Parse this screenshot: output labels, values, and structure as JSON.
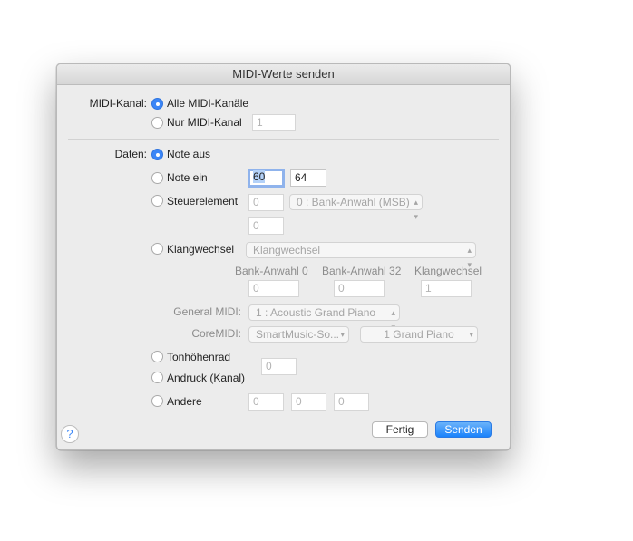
{
  "window": {
    "title": "MIDI-Werte senden"
  },
  "midi_kanal": {
    "label": "MIDI-Kanal:",
    "option_all": "Alle MIDI-Kanäle",
    "option_only": "Nur MIDI-Kanal",
    "channel_value": "1",
    "selected": "all"
  },
  "daten": {
    "label": "Daten:",
    "note_aus": "Note aus",
    "note_ein": "Note ein",
    "note_ein_value1": "60",
    "note_ein_value2": "64",
    "steuerelement": "Steuerelement",
    "steuer_value": "0",
    "steuer_popup": "0 : Bank-Anwahl (MSB)",
    "steuer_value2": "0",
    "klangwechsel": "Klangwechsel",
    "klang_popup": "Klangwechsel",
    "bank0_label": "Bank-Anwahl 0",
    "bank32_label": "Bank-Anwahl 32",
    "klang_label": "Klangwechsel",
    "bank0_value": "0",
    "bank32_value": "0",
    "klang_value": "1",
    "general_midi_label": "General MIDI:",
    "general_midi_value": "1 : Acoustic Grand Piano",
    "coremidi_label": "CoreMIDI:",
    "coremidi_value1": "SmartMusic-So...",
    "coremidi_value2": "1 Grand Piano",
    "tonhoehenrad": "Tonhöhenrad",
    "andruck": "Andruck (Kanal)",
    "pitch_value": "0",
    "andere": "Andere",
    "andere_v1": "0",
    "andere_v2": "0",
    "andere_v3": "0",
    "selected": "note_aus"
  },
  "buttons": {
    "fertig": "Fertig",
    "senden": "Senden",
    "help": "?"
  },
  "colors": {
    "accent": "#3b86f7",
    "dialog_bg": "#ececec"
  }
}
